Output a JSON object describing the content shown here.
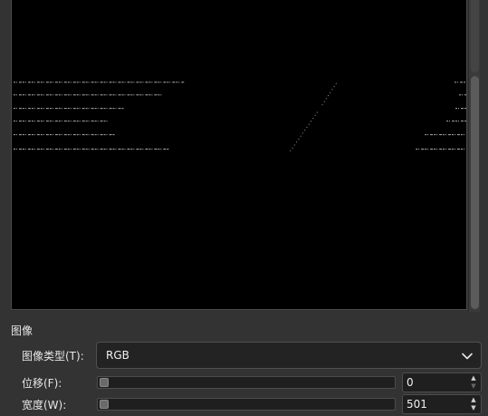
{
  "section": {
    "title": "图像"
  },
  "image_type": {
    "label": "图像类型(T):",
    "selected": "RGB",
    "chevron_icon": "chevron-down-icon"
  },
  "offset": {
    "label": "位移(F):",
    "value": "0"
  },
  "width": {
    "label": "宽度(W):",
    "value": "501"
  },
  "colors": {
    "preview_background": "#000000",
    "panel_background": "#333333"
  }
}
